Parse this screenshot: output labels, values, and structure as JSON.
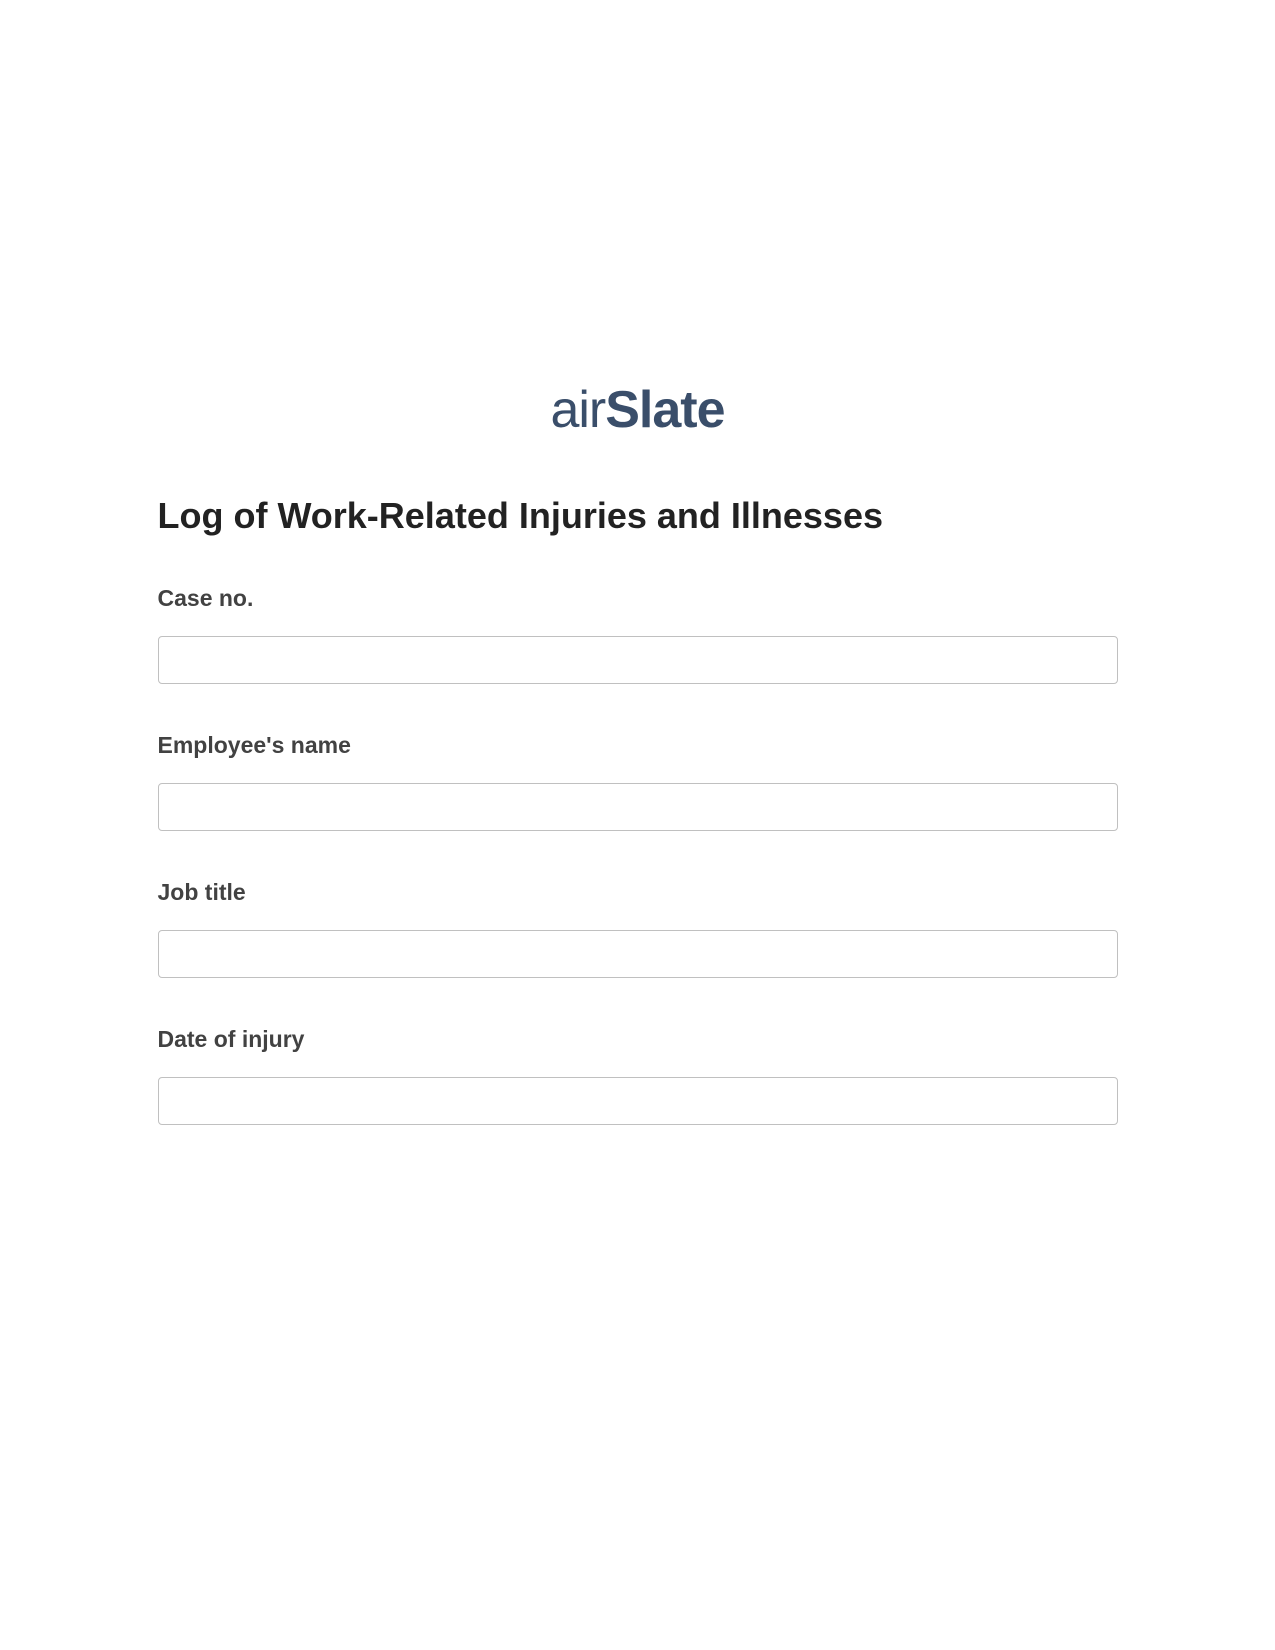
{
  "logo": {
    "prefix": "air",
    "suffix": "Slate"
  },
  "form": {
    "title": "Log of Work-Related Injuries and Illnesses",
    "fields": [
      {
        "label": "Case no.",
        "value": ""
      },
      {
        "label": "Employee's name",
        "value": ""
      },
      {
        "label": "Job title",
        "value": ""
      },
      {
        "label": "Date of injury",
        "value": ""
      }
    ]
  }
}
